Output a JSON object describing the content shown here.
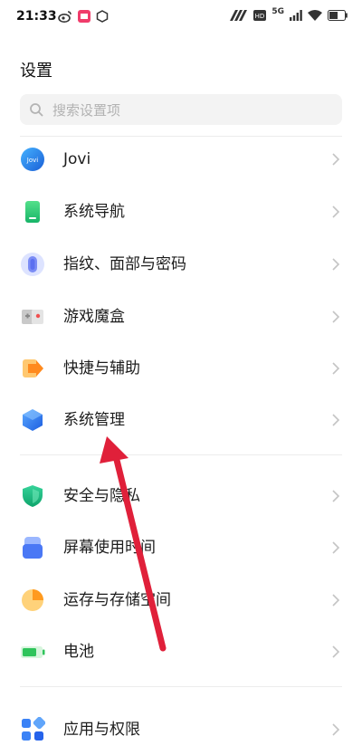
{
  "status_bar": {
    "time": "21:33",
    "network": "5G",
    "battery": "56"
  },
  "page": {
    "title": "设置"
  },
  "search": {
    "placeholder": "搜索设置项"
  },
  "items": [
    {
      "label": "Jovi",
      "icon": "jovi-icon",
      "icon_text": "Jovi"
    },
    {
      "label": "系统导航",
      "icon": "system-navigation-icon"
    },
    {
      "label": "指纹、面部与密码",
      "icon": "fingerprint-icon"
    },
    {
      "label": "游戏魔盒",
      "icon": "game-box-icon"
    },
    {
      "label": "快捷与辅助",
      "icon": "shortcut-assist-icon"
    },
    {
      "label": "系统管理",
      "icon": "system-management-icon"
    },
    {
      "label": "安全与隐私",
      "icon": "security-shield-icon"
    },
    {
      "label": "屏幕使用时间",
      "icon": "screen-time-icon"
    },
    {
      "label": "运存与存储空间",
      "icon": "storage-pie-icon"
    },
    {
      "label": "电池",
      "icon": "battery-icon"
    },
    {
      "label": "应用与权限",
      "icon": "apps-grid-icon"
    }
  ],
  "colors": {
    "annotation_arrow": "#e0203a",
    "accent_blue": "#2d7ff9"
  }
}
